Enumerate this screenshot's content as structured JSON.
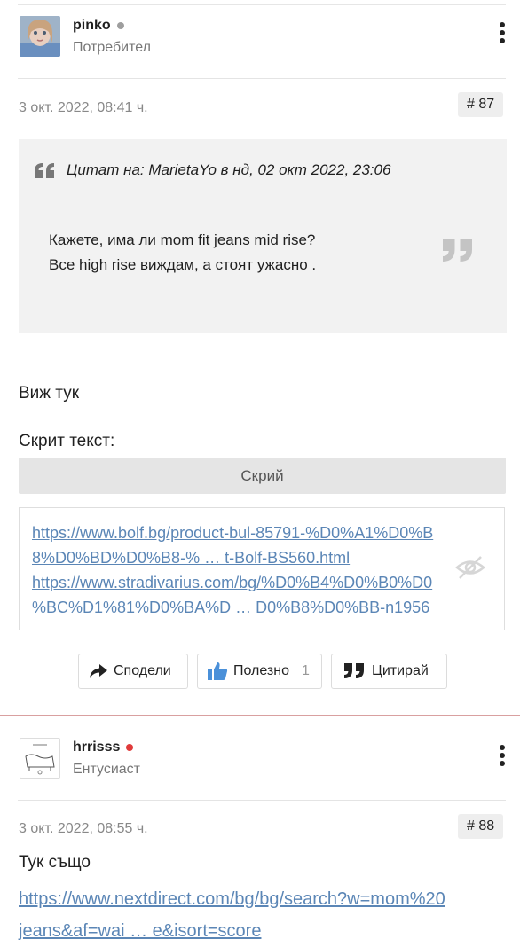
{
  "post1": {
    "username": "pinko",
    "status_color": "#9e9e9e",
    "role": "Потребител",
    "date": "3 окт. 2022, 08:41 ч.",
    "number": "# 87",
    "quote": {
      "header": "Цитат на: MarietaYo в нд, 02 окт 2022, 23:06",
      "line1": "Кажете, има ли mom fit jeans mid rise?",
      "line2": "Все high rise виждам, а стоят ужасно ."
    },
    "body": "Виж тук",
    "hidden_label": "Скрит текст:",
    "hide_button": "Скрий",
    "links": {
      "line1": "https://www.bolf.bg/product-bul-85791-%D0%A1%D0%B",
      "line2": "8%D0%BD%D0%B8-% … t-Bolf-BS560.html",
      "line3": "https://www.stradivarius.com/bg/%D0%B4%D0%B0%D0",
      "line4": "%BC%D1%81%D0%BA%D … D0%B8%D0%BB-n1956"
    },
    "actions": {
      "share": "Сподели",
      "useful": "Полезно",
      "useful_count": "1",
      "quote": "Цитирай"
    }
  },
  "post2": {
    "username": "hrrisss",
    "status_color": "#e03a3a",
    "role": "Ентусиаст",
    "date": "3 окт. 2022, 08:55 ч.",
    "number": "# 88",
    "body": "Тук също",
    "link_line1": "https://www.nextdirect.com/bg/bg/search?w=mom%20",
    "link_line2": "jeans&af=wai … e&isort=score"
  },
  "icons": {
    "share": "share-arrow-icon",
    "useful": "thumbs-up-icon",
    "quote": "quote-icon",
    "hidden": "eye-slash-icon",
    "menu": "kebab-menu-icon"
  },
  "colors": {
    "link": "#5b86b6",
    "thumb": "#4a90d9",
    "post_divider": "#d9a0a0"
  }
}
